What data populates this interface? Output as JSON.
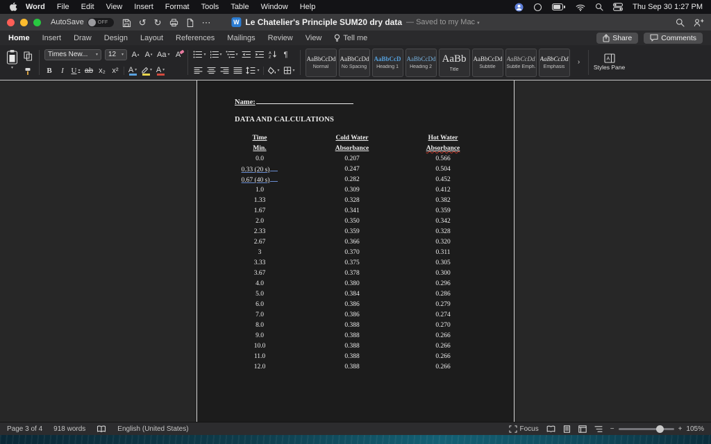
{
  "menu_bar": {
    "items": [
      "Word",
      "File",
      "Edit",
      "View",
      "Insert",
      "Format",
      "Tools",
      "Table",
      "Window",
      "Help"
    ],
    "clock": "Thu Sep 30 1:27 PM"
  },
  "title_bar": {
    "autosave_label": "AutoSave",
    "autosave_state": "OFF",
    "word_logo": "W",
    "doc_title": "Le Chatelier's Principle SUM20 dry data",
    "save_status": "— Saved to my Mac"
  },
  "glyphs": {
    "undo": "↺",
    "redo": "↻",
    "more": "⋯",
    "bold": "B",
    "italic": "I",
    "underline": "U",
    "strikethrough": "ab",
    "subscript": "x₂",
    "superscript": "x²",
    "grow_font": "A",
    "shrink_font": "A",
    "change_case": "Aa",
    "clear_formatting": "A",
    "text_effects": "A",
    "font_color": "A",
    "pilcrow": "¶",
    "expander": "›"
  },
  "ribbon": {
    "tabs": [
      "Home",
      "Insert",
      "Draw",
      "Design",
      "Layout",
      "References",
      "Mailings",
      "Review",
      "View"
    ],
    "active_tab": "Home",
    "tell_me_label": "Tell me",
    "share_label": "Share",
    "comments_label": "Comments",
    "font": {
      "name": "Times New...",
      "size": "12"
    },
    "styles": [
      {
        "sample": "AaBbCcDdEe",
        "label": "Normal"
      },
      {
        "sample": "AaBbCcDdEe",
        "label": "No Spacing"
      },
      {
        "sample": "AaBbCcD",
        "label": "Heading 1"
      },
      {
        "sample": "AaBbCcDdE",
        "label": "Heading 2"
      },
      {
        "sample": "AaBb",
        "label": "Title"
      },
      {
        "sample": "AaBbCcDdEe",
        "label": "Subtitle"
      },
      {
        "sample": "AaBbCcDdEe",
        "label": "Subtle Emph..."
      },
      {
        "sample": "AaBbCcDdEe",
        "label": "Emphasis"
      }
    ],
    "styles_pane_label": "Styles Pane"
  },
  "document": {
    "name_label": "Name:",
    "section_heading": "DATA AND CALCULATIONS",
    "table": {
      "headers": [
        "Time",
        "Cold Water",
        "Hot Water"
      ],
      "subheaders": [
        "Min.",
        "Absorbance",
        "Absorbance"
      ],
      "grammar_rows": [
        1,
        2
      ],
      "rows": [
        [
          "0.0",
          "0.207",
          "0.566"
        ],
        [
          "0.33 (20 s)",
          "0.247",
          "0.504"
        ],
        [
          "0.67 (40 s)",
          "0.282",
          "0.452"
        ],
        [
          "1.0",
          "0.309",
          "0.412"
        ],
        [
          "1.33",
          "0.328",
          "0.382"
        ],
        [
          "1.67",
          "0.341",
          "0.359"
        ],
        [
          "2.0",
          "0.350",
          "0.342"
        ],
        [
          "2.33",
          "0.359",
          "0.328"
        ],
        [
          "2.67",
          "0.366",
          "0.320"
        ],
        [
          "3",
          "0.370",
          "0.311"
        ],
        [
          "3.33",
          "0.375",
          "0.305"
        ],
        [
          "3.67",
          "0.378",
          "0.300"
        ],
        [
          "4.0",
          "0.380",
          "0.296"
        ],
        [
          "5.0",
          "0.384",
          "0.286"
        ],
        [
          "6.0",
          "0.386",
          "0.279"
        ],
        [
          "7.0",
          "0.386",
          "0.274"
        ],
        [
          "8.0",
          "0.388",
          "0.270"
        ],
        [
          "9.0",
          "0.388",
          "0.266"
        ],
        [
          "10.0",
          "0.388",
          "0.266"
        ],
        [
          "11.0",
          "0.388",
          "0.266"
        ],
        [
          "12.0",
          "0.388",
          "0.266"
        ]
      ]
    }
  },
  "status_bar": {
    "page_info": "Page 3 of 4",
    "word_count": "918 words",
    "language": "English (United States)",
    "focus_label": "Focus",
    "zoom_minus": "−",
    "zoom_plus": "+",
    "zoom_level": "105%"
  },
  "colors": {
    "accent_blue": "#2b7cd3",
    "heading_blue": "#55a0dc",
    "traffic_red": "#ff5f57",
    "traffic_yellow": "#febc2e",
    "traffic_green": "#28c840"
  }
}
